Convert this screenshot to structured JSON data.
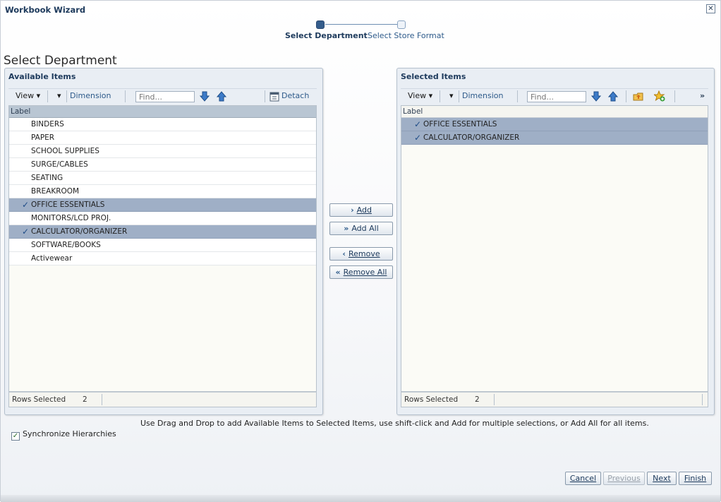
{
  "window": {
    "title": "Workbook Wizard",
    "close_glyph": "✕"
  },
  "train": {
    "steps": [
      "Select Department",
      "Select Store Format"
    ],
    "current": 0
  },
  "page_title": "Select Department",
  "available": {
    "header": "Available Items",
    "toolbar": {
      "view": "View ▾",
      "dimension": "Dimension",
      "find_placeholder": "Find...",
      "detach": "Detach"
    },
    "column_label": "Label",
    "rows": [
      {
        "label": "BINDERS",
        "selected": false
      },
      {
        "label": "PAPER",
        "selected": false
      },
      {
        "label": "SCHOOL SUPPLIES",
        "selected": false
      },
      {
        "label": "SURGE/CABLES",
        "selected": false
      },
      {
        "label": "SEATING",
        "selected": false
      },
      {
        "label": "BREAKROOM",
        "selected": false
      },
      {
        "label": "OFFICE ESSENTIALS",
        "selected": true
      },
      {
        "label": "MONITORS/LCD PROJ.",
        "selected": false
      },
      {
        "label": "CALCULATOR/ORGANIZER",
        "selected": true
      },
      {
        "label": "SOFTWARE/BOOKS",
        "selected": false
      },
      {
        "label": "Activewear",
        "selected": false
      }
    ],
    "rows_selected_label": "Rows Selected",
    "rows_selected_value": "2"
  },
  "selected": {
    "header": "Selected Items",
    "toolbar": {
      "view": "View ▾",
      "dimension": "Dimension",
      "find_placeholder": "Find...",
      "overflow": "»"
    },
    "column_label": "Label",
    "rows": [
      {
        "label": "OFFICE ESSENTIALS",
        "selected": true
      },
      {
        "label": "CALCULATOR/ORGANIZER",
        "selected": true
      }
    ],
    "rows_selected_label": "Rows Selected",
    "rows_selected_value": "2"
  },
  "shuttle": {
    "add": "Add",
    "add_all": "Add All",
    "remove": "Remove",
    "remove_all": "Remove All"
  },
  "hint": "Use Drag and Drop to add Available Items to Selected Items, use shift-click and Add for multiple selections, or Add All for all items.",
  "sync": {
    "label": "Synchronize Hierarchies",
    "checked": true
  },
  "footer": {
    "cancel": "Cancel",
    "previous": "Previous",
    "next": "Next",
    "finish": "Finish"
  },
  "colors": {
    "accent": "#1d3a5c",
    "selection": "#9fafc6",
    "header_bg": "#b9c6d3"
  }
}
